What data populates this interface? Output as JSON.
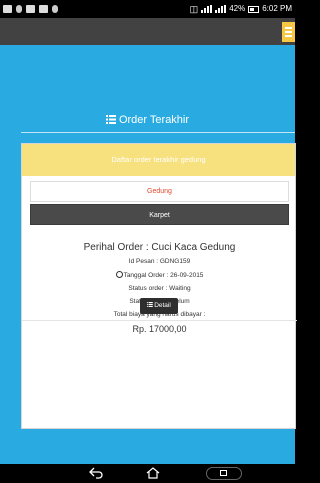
{
  "status_bar": {
    "battery_percent": "42%",
    "time": "6:02 PM",
    "left_icons": [
      "notification-icon",
      "hearing-icon",
      "image-icon",
      "gallery-icon",
      "location-icon"
    ],
    "right_icons": [
      "wifi-icon",
      "signal-icon",
      "signal-icon",
      "battery-icon"
    ]
  },
  "header": {
    "menu_icon": "hamburger-icon",
    "menu_color": "#f7c843"
  },
  "page": {
    "section_title": "Order Terakhir",
    "section_icon": "list-icon",
    "background_color": "#29abe2"
  },
  "card": {
    "header_text": "Daftar order terakhir gedung",
    "header_color": "#f7e07e",
    "buttons": [
      {
        "label": "Gedung",
        "active": false
      },
      {
        "label": "Karpet",
        "active": true
      }
    ],
    "order": {
      "title": "Perihal Order : Cuci Kaca Gedung",
      "id": "Id Pesan : GDNG159",
      "date": "Tanggal Order : 26-09-2015",
      "status_order": "Status order : Waiting",
      "status_bayar": "Status bayar : Belum",
      "total_label": "Total biaya yang harus dibayar :",
      "price": "Rp. 17000,00",
      "detail_button": "Detail"
    }
  },
  "nav_bar": {
    "icons": [
      "back-icon",
      "home-icon",
      "recents-icon"
    ]
  }
}
